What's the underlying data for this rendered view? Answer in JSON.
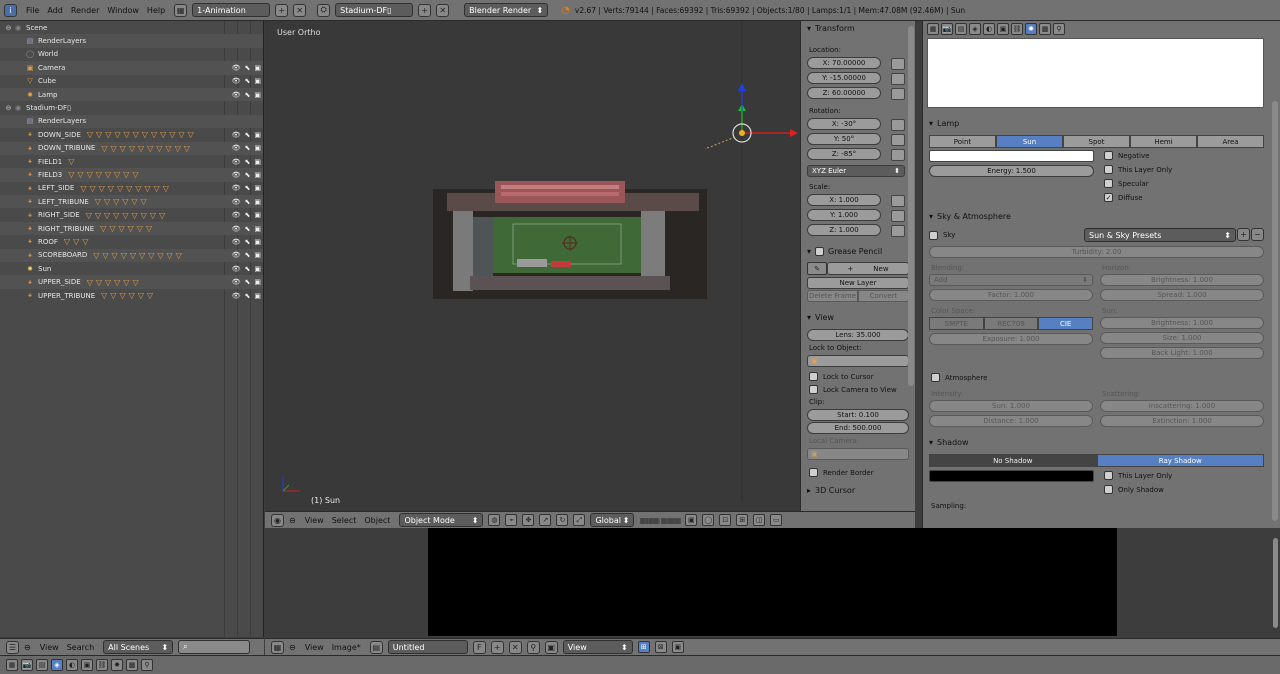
{
  "topbar": {
    "menus": [
      "File",
      "Add",
      "Render",
      "Window",
      "Help"
    ],
    "screen_layout": "1-Animation",
    "scene": "Stadium-DF▯",
    "render_engine": "Blender Render",
    "stats": "v2.67 | Verts:79144 | Faces:69392 | Tris:69392 | Objects:1/80 | Lamps:1/1 | Mem:47.08M (92.46M) | Sun"
  },
  "outliner": {
    "rows": [
      {
        "label": "Scene",
        "icon": "scene-icon",
        "indent": 0,
        "tw": "⊖"
      },
      {
        "label": "RenderLayers",
        "icon": "renderlayers-icon",
        "indent": 1
      },
      {
        "label": "World",
        "icon": "world-icon",
        "indent": 1
      },
      {
        "label": "Camera",
        "icon": "camera-icon",
        "indent": 1,
        "vis": true
      },
      {
        "label": "Cube",
        "icon": "cube-icon",
        "indent": 1,
        "vis": true
      },
      {
        "label": "Lamp",
        "icon": "lamp-icon",
        "indent": 1,
        "vis": true
      },
      {
        "label": "Stadium-DF▯",
        "icon": "scene-icon",
        "indent": 0,
        "tw": "⊖"
      },
      {
        "label": "RenderLayers",
        "icon": "renderlayers-icon",
        "indent": 1
      },
      {
        "label": "DOWN_SIDE",
        "icon": "empty-icon",
        "indent": 1,
        "tris": 12,
        "vis": true
      },
      {
        "label": "DOWN_TRIBUNE",
        "icon": "empty-icon",
        "indent": 1,
        "tris": 10,
        "vis": true
      },
      {
        "label": "FIELD1",
        "icon": "empty-icon",
        "indent": 1,
        "tris": 1,
        "vis": true
      },
      {
        "label": "FIELD3",
        "icon": "empty-icon",
        "indent": 1,
        "tris": 8,
        "vis": true
      },
      {
        "label": "LEFT_SIDE",
        "icon": "empty-icon",
        "indent": 1,
        "tris": 10,
        "vis": true
      },
      {
        "label": "LEFT_TRIBUNE",
        "icon": "empty-icon",
        "indent": 1,
        "tris": 6,
        "vis": true
      },
      {
        "label": "RIGHT_SIDE",
        "icon": "empty-icon",
        "indent": 1,
        "tris": 9,
        "vis": true
      },
      {
        "label": "RIGHT_TRIBUNE",
        "icon": "empty-icon",
        "indent": 1,
        "tris": 6,
        "vis": true
      },
      {
        "label": "ROOF",
        "icon": "empty-icon",
        "indent": 1,
        "tris": 3,
        "vis": true
      },
      {
        "label": "SCOREBOARD",
        "icon": "empty-icon",
        "indent": 1,
        "tris": 10,
        "vis": true
      },
      {
        "label": "Sun",
        "icon": "sun-icon",
        "indent": 1,
        "vis": true
      },
      {
        "label": "UPPER_SIDE",
        "icon": "empty-icon",
        "indent": 1,
        "tris": 6,
        "vis": true
      },
      {
        "label": "UPPER_TRIBUNE",
        "icon": "empty-icon",
        "indent": 1,
        "tris": 6,
        "vis": true
      }
    ]
  },
  "viewport": {
    "view_name": "User Ortho",
    "active_object": "(1) Sun"
  },
  "view_header": {
    "menus": [
      "View",
      "Select",
      "Object"
    ],
    "mode": "Object Mode",
    "orientation": "Global"
  },
  "npanel": {
    "transform_title": "Transform",
    "location_label": "Location:",
    "location": [
      "X: 70.00000",
      "Y: -15.00000",
      "Z: 60.00000"
    ],
    "rotation_label": "Rotation:",
    "rotation": [
      "X: -30°",
      "Y: 50°",
      "Z: -85°"
    ],
    "rotation_mode": "XYZ Euler",
    "scale_label": "Scale:",
    "scale": [
      "X: 1.000",
      "Y: 1.000",
      "Z: 1.000"
    ],
    "grease_title": "Grease Pencil",
    "new_label": "New",
    "new_layer": "New Layer",
    "delete_frame": "Delete Frame",
    "convert": "Convert",
    "view_title": "View",
    "lens": "Lens: 35.000",
    "lock_object": "Lock to Object:",
    "lock_cursor": "Lock to Cursor",
    "lock_camera": "Lock Camera to View",
    "clip": "Clip:",
    "clip_start": "Start: 0.100",
    "clip_end": "End: 500.000",
    "local_camera": "Local Camera:",
    "render_border": "Render Border",
    "cursor_title": "3D Cursor"
  },
  "props": {
    "lamp_title": "Lamp",
    "lamp_types": [
      "Point",
      "Sun",
      "Spot",
      "Hemi",
      "Area"
    ],
    "lamp_type_active": "Sun",
    "energy": "Energy: 1.500",
    "negative": "Negative",
    "this_layer": "This Layer Only",
    "specular": "Specular",
    "diffuse": "Diffuse",
    "sky_title": "Sky & Atmosphere",
    "sky": "Sky",
    "sky_presets": "Sun & Sky Presets",
    "turbidity": "Turbidity: 2.00",
    "blending": "Blending:",
    "horizon": "Horizon:",
    "add": "Add",
    "h_brightness": "Brightness: 1.000",
    "h_spread": "Spread: 1.000",
    "factor": "Factor: 1.000",
    "color_space": "Color Space:",
    "sun_label": "Sun:",
    "color_spaces": [
      "SMPTE",
      "REC709",
      "CIE"
    ],
    "color_space_active": "CIE",
    "s_brightness": "Brightness: 1.000",
    "exposure": "Exposure: 1.000",
    "s_size": "Size: 1.000",
    "back_light": "Back Light: 1.000",
    "atmosphere": "Atmosphere",
    "intensity": "Intensity:",
    "scattering": "Scattering:",
    "a_sun": "Sun: 1.000",
    "a_insc": "Inscattering: 1.000",
    "a_dist": "Distance: 1.000",
    "a_ext": "Extinction: 1.000",
    "shadow_title": "Shadow",
    "no_shadow": "No Shadow",
    "ray_shadow": "Ray Shadow",
    "sh_this_layer": "This Layer Only",
    "only_shadow": "Only Shadow",
    "sampling": "Sampling:"
  },
  "outliner_header": {
    "menus": [
      "View",
      "Search"
    ],
    "filter": "All Scenes"
  },
  "image_header": {
    "menus": [
      "View",
      "Image*"
    ],
    "image_name": "Untitled",
    "f_label": "F",
    "view_mode": "View"
  },
  "colors": {
    "accent": "#5680c2",
    "panel": "#727272",
    "triangle": "#e6a04a"
  }
}
